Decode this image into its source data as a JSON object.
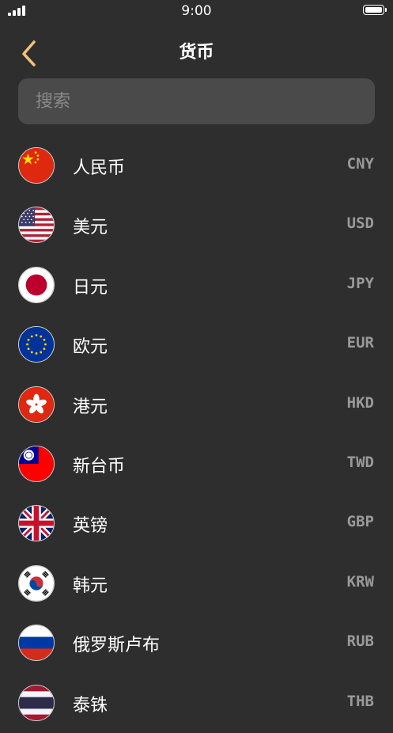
{
  "status_bar": {
    "time": "9:00"
  },
  "nav": {
    "title": "货币"
  },
  "search": {
    "placeholder": "搜索",
    "value": ""
  },
  "currencies": [
    {
      "name": "人民币",
      "code": "CNY",
      "flag": "china-flag-icon"
    },
    {
      "name": "美元",
      "code": "USD",
      "flag": "usa-flag-icon"
    },
    {
      "name": "日元",
      "code": "JPY",
      "flag": "japan-flag-icon"
    },
    {
      "name": "欧元",
      "code": "EUR",
      "flag": "eu-flag-icon"
    },
    {
      "name": "港元",
      "code": "HKD",
      "flag": "hong-kong-flag-icon"
    },
    {
      "name": "新台币",
      "code": "TWD",
      "flag": "taiwan-flag-icon"
    },
    {
      "name": "英镑",
      "code": "GBP",
      "flag": "uk-flag-icon"
    },
    {
      "name": "韩元",
      "code": "KRW",
      "flag": "korea-flag-icon"
    },
    {
      "name": "俄罗斯卢布",
      "code": "RUB",
      "flag": "russia-flag-icon"
    },
    {
      "name": "泰铢",
      "code": "THB",
      "flag": "thailand-flag-icon"
    }
  ],
  "colors": {
    "background": "#2e2e2e",
    "accent": "#f0c27b",
    "search_bg": "#4a4a4a",
    "code_text": "#9a9a9a"
  }
}
